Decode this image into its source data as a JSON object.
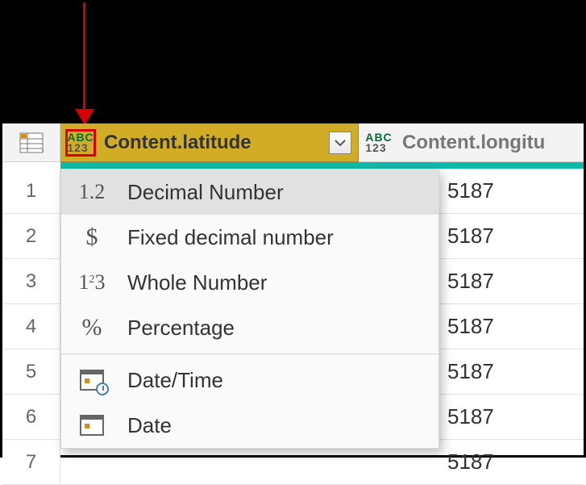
{
  "columns": [
    {
      "name": "Content.latitude",
      "type_icon": "abc123",
      "selected": true
    },
    {
      "name": "Content.longitu",
      "type_icon": "abc123",
      "selected": false
    }
  ],
  "rows": [
    {
      "n": "1",
      "vis": "5187"
    },
    {
      "n": "2",
      "vis": "5187"
    },
    {
      "n": "3",
      "vis": "5187"
    },
    {
      "n": "4",
      "vis": "5187"
    },
    {
      "n": "5",
      "vis": "5187"
    },
    {
      "n": "6",
      "vis": "5187"
    },
    {
      "n": "7",
      "vis": "5187"
    }
  ],
  "type_menu": {
    "items": [
      {
        "icon": "decimal",
        "label": "Decimal Number",
        "hover": true
      },
      {
        "icon": "currency",
        "label": "Fixed decimal number"
      },
      {
        "icon": "whole",
        "label": "Whole Number"
      },
      {
        "icon": "percent",
        "label": "Percentage"
      },
      {
        "sep": true
      },
      {
        "icon": "datetime",
        "label": "Date/Time"
      },
      {
        "icon": "date",
        "label": "Date"
      }
    ]
  },
  "icon_text": {
    "decimal": "1.2",
    "currency": "$",
    "percent": "%"
  }
}
